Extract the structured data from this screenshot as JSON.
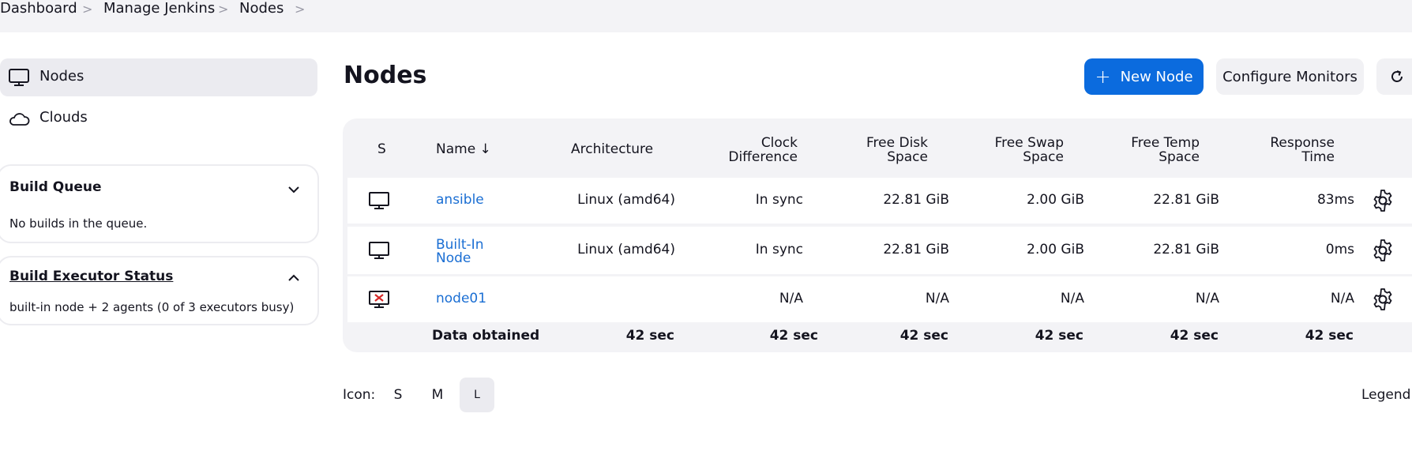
{
  "breadcrumb": [
    "Dashboard",
    "Manage Jenkins",
    "Nodes"
  ],
  "sidebar": {
    "items": [
      {
        "label": "Nodes",
        "icon": "computer-icon",
        "active": true
      },
      {
        "label": "Clouds",
        "icon": "cloud-icon",
        "active": false
      }
    ],
    "build_queue": {
      "title": "Build Queue",
      "body": "No builds in the queue."
    },
    "executor_status": {
      "title": "Build Executor Status",
      "body": "built-in node + 2 agents (0 of 3 executors busy)"
    }
  },
  "main": {
    "title": "Nodes",
    "buttons": {
      "new_node": "New Node",
      "configure": "Configure Monitors"
    },
    "table": {
      "headers": {
        "s": "S",
        "name": "Name ↓",
        "arch": "Architecture",
        "clock1": "Clock",
        "clock2": "Difference",
        "disk1": "Free Disk",
        "disk2": "Space",
        "swap1": "Free Swap",
        "swap2": "Space",
        "temp1": "Free Temp",
        "temp2": "Space",
        "resp1": "Response",
        "resp2": "Time"
      },
      "rows": [
        {
          "name": "ansible",
          "name2": "",
          "arch": "Linux (amd64)",
          "clock": "In sync",
          "disk": "22.81 GiB",
          "swap": "2.00 GiB",
          "temp": "22.81 GiB",
          "resp": "83ms"
        },
        {
          "name": "Built-In",
          "name2": "Node",
          "arch": "Linux (amd64)",
          "clock": "In sync",
          "disk": "22.81 GiB",
          "swap": "2.00 GiB",
          "temp": "22.81 GiB",
          "resp": "0ms"
        },
        {
          "name": "node01",
          "name2": "",
          "arch": "",
          "clock": "N/A",
          "disk": "N/A",
          "swap": "N/A",
          "temp": "N/A",
          "resp": "N/A"
        }
      ],
      "footer": {
        "label": "Data obtained",
        "arch": "42 sec",
        "clock": "42 sec",
        "disk": "42 sec",
        "swap": "42 sec",
        "temp": "42 sec",
        "resp": "42 sec"
      }
    },
    "icon_size": {
      "label": "Icon:",
      "options": [
        "S",
        "M",
        "L"
      ],
      "selected": "L"
    },
    "legend": "Legend"
  },
  "colors": {
    "accent": "#0b6bde",
    "link": "#1a6ed3",
    "offline": "#d62828"
  }
}
